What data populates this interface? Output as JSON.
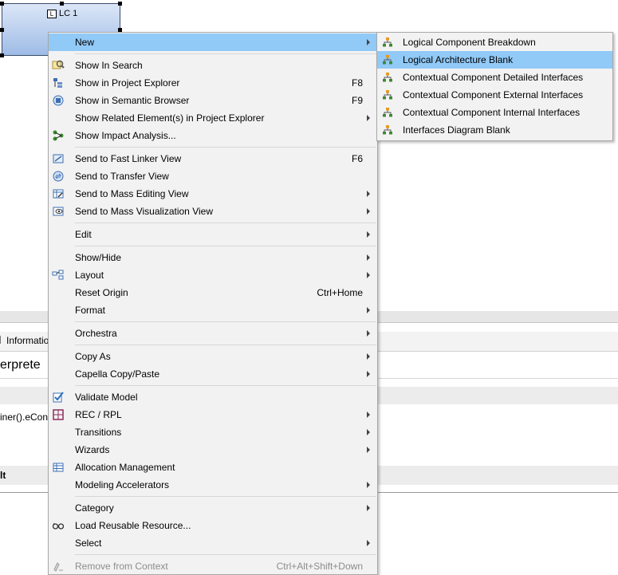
{
  "diagram": {
    "component_label": "LC 1",
    "component_icon_letter": "L"
  },
  "background": {
    "tab_label": "Informatio",
    "interpreter_text": "erprete",
    "expression_text": "iner().eCon",
    "result_label": "lt"
  },
  "context_menu": {
    "items": [
      {
        "label": "New",
        "shortcut": "",
        "submenu": true,
        "icon": "none"
      },
      {
        "label": "Show In Search",
        "shortcut": "",
        "submenu": false,
        "icon": "search-icon"
      },
      {
        "label": "Show in Project Explorer",
        "shortcut": "F8",
        "submenu": false,
        "icon": "project-explorer-icon"
      },
      {
        "label": "Show in Semantic Browser",
        "shortcut": "F9",
        "submenu": false,
        "icon": "semantic-browser-icon"
      },
      {
        "label": "Show Related Element(s) in Project Explorer",
        "shortcut": "",
        "submenu": true,
        "icon": "none"
      },
      {
        "label": "Show Impact Analysis...",
        "shortcut": "",
        "submenu": false,
        "icon": "impact-analysis-icon"
      },
      {
        "label": "Send to Fast Linker View",
        "shortcut": "F6",
        "submenu": false,
        "icon": "fast-linker-icon"
      },
      {
        "label": "Send to Transfer View",
        "shortcut": "",
        "submenu": false,
        "icon": "transfer-icon"
      },
      {
        "label": "Send to Mass Editing View",
        "shortcut": "",
        "submenu": true,
        "icon": "mass-editing-icon"
      },
      {
        "label": "Send to Mass Visualization View",
        "shortcut": "",
        "submenu": true,
        "icon": "mass-visualization-icon"
      },
      {
        "label": "Edit",
        "shortcut": "",
        "submenu": true,
        "icon": "none"
      },
      {
        "label": "Show/Hide",
        "shortcut": "",
        "submenu": true,
        "icon": "none"
      },
      {
        "label": "Layout",
        "shortcut": "",
        "submenu": true,
        "icon": "layout-icon"
      },
      {
        "label": "Reset Origin",
        "shortcut": "Ctrl+Home",
        "submenu": false,
        "icon": "none"
      },
      {
        "label": "Format",
        "shortcut": "",
        "submenu": true,
        "icon": "none"
      },
      {
        "label": "Orchestra",
        "shortcut": "",
        "submenu": true,
        "icon": "none"
      },
      {
        "label": "Copy As",
        "shortcut": "",
        "submenu": true,
        "icon": "none"
      },
      {
        "label": "Capella Copy/Paste",
        "shortcut": "",
        "submenu": true,
        "icon": "none"
      },
      {
        "label": "Validate Model",
        "shortcut": "",
        "submenu": false,
        "icon": "validate-icon"
      },
      {
        "label": "REC / RPL",
        "shortcut": "",
        "submenu": true,
        "icon": "rec-rpl-icon"
      },
      {
        "label": "Transitions",
        "shortcut": "",
        "submenu": true,
        "icon": "none"
      },
      {
        "label": "Wizards",
        "shortcut": "",
        "submenu": true,
        "icon": "none"
      },
      {
        "label": "Allocation Management",
        "shortcut": "",
        "submenu": false,
        "icon": "allocation-icon"
      },
      {
        "label": "Modeling Accelerators",
        "shortcut": "",
        "submenu": true,
        "icon": "none"
      },
      {
        "label": "Category",
        "shortcut": "",
        "submenu": true,
        "icon": "none"
      },
      {
        "label": "Load Reusable Resource...",
        "shortcut": "",
        "submenu": false,
        "icon": "glasses-icon"
      },
      {
        "label": "Select",
        "shortcut": "",
        "submenu": true,
        "icon": "none"
      },
      {
        "label": "Remove from Context",
        "shortcut": "Ctrl+Alt+Shift+Down",
        "submenu": false,
        "icon": "remove-context-icon"
      }
    ]
  },
  "new_submenu": {
    "items": [
      {
        "label": "Logical Component Breakdown"
      },
      {
        "label": "Logical Architecture Blank"
      },
      {
        "label": "Contextual Component Detailed Interfaces"
      },
      {
        "label": "Contextual Component External Interfaces"
      },
      {
        "label": "Contextual Component Internal Interfaces"
      },
      {
        "label": "Interfaces Diagram Blank"
      }
    ]
  },
  "colors": {
    "highlight": "#91c9f7",
    "menu_bg": "#f2f2f2",
    "diagram_icon_green": "#3c8a2e",
    "diagram_icon_orange": "#e39b23"
  }
}
